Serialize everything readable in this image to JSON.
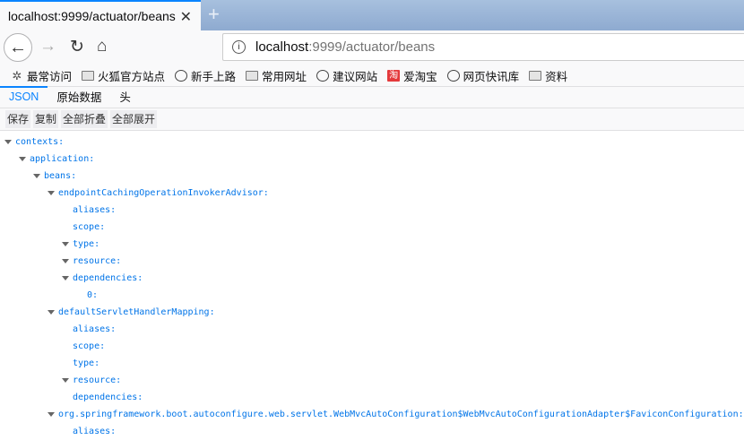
{
  "tab": {
    "title": "localhost:9999/actuator/beans",
    "close": "✕",
    "new": "+"
  },
  "nav": {
    "url_host": "localhost",
    "url_rest": ":9999/actuator/beans",
    "info": "i"
  },
  "bookmarks": [
    {
      "label": "最常访问",
      "icon": "gear-icon"
    },
    {
      "label": "火狐官方站点",
      "icon": "folder-icon"
    },
    {
      "label": "新手上路",
      "icon": "globe-icon"
    },
    {
      "label": "常用网址",
      "icon": "folder-icon"
    },
    {
      "label": "建议网站",
      "icon": "globe-icon"
    },
    {
      "label": "爱淘宝",
      "icon": "taobao-icon"
    },
    {
      "label": "网页快讯库",
      "icon": "globe-icon"
    },
    {
      "label": "资料",
      "icon": "folder-icon"
    }
  ],
  "viewer_tabs": [
    "JSON",
    "原始数据",
    "头"
  ],
  "toolbar": [
    "保存",
    "复制",
    "全部折叠",
    "全部展开"
  ],
  "tree": [
    {
      "key": "contexts:",
      "level": 0,
      "expand": true
    },
    {
      "key": "application:",
      "level": 1,
      "expand": true
    },
    {
      "key": "beans:",
      "level": 2,
      "expand": true
    },
    {
      "key": "endpointCachingOperationInvokerAdvisor:",
      "level": 3,
      "expand": true
    },
    {
      "key": "aliases:",
      "level": 4,
      "expand": false
    },
    {
      "key": "scope:",
      "level": 4,
      "expand": false
    },
    {
      "key": "type:",
      "level": 4,
      "expand": true
    },
    {
      "key": "resource:",
      "level": 4,
      "expand": true
    },
    {
      "key": "dependencies:",
      "level": 4,
      "expand": true
    },
    {
      "key": "0:",
      "level": 5,
      "expand": false
    },
    {
      "key": "defaultServletHandlerMapping:",
      "level": 3,
      "expand": true
    },
    {
      "key": "aliases:",
      "level": 4,
      "expand": false
    },
    {
      "key": "scope:",
      "level": 4,
      "expand": false
    },
    {
      "key": "type:",
      "level": 4,
      "expand": false
    },
    {
      "key": "resource:",
      "level": 4,
      "expand": true
    },
    {
      "key": "dependencies:",
      "level": 4,
      "expand": false
    },
    {
      "key": "org.springframework.boot.autoconfigure.web.servlet.WebMvcAutoConfiguration$WebMvcAutoConfigurationAdapter$FaviconConfiguration:",
      "level": 3,
      "expand": true
    },
    {
      "key": "aliases:",
      "level": 4,
      "expand": false
    }
  ]
}
